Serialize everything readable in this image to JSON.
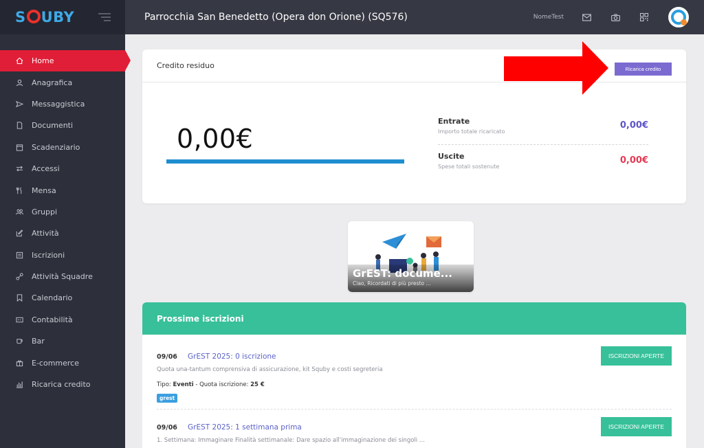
{
  "sidebar": {
    "logo_text": "SQUBY",
    "items": [
      {
        "label": "Home",
        "icon": "home-icon",
        "active": true
      },
      {
        "label": "Anagrafica",
        "icon": "user-icon"
      },
      {
        "label": "Messaggistica",
        "icon": "send-icon"
      },
      {
        "label": "Documenti",
        "icon": "document-icon"
      },
      {
        "label": "Scadenziario",
        "icon": "calendar-icon"
      },
      {
        "label": "Accessi",
        "icon": "swap-icon"
      },
      {
        "label": "Mensa",
        "icon": "cutlery-icon"
      },
      {
        "label": "Gruppi",
        "icon": "group-icon"
      },
      {
        "label": "Attività",
        "icon": "edit-icon"
      },
      {
        "label": "Iscrizioni",
        "icon": "list-icon"
      },
      {
        "label": "Attività Squadre",
        "icon": "link-icon"
      },
      {
        "label": "Calendario",
        "icon": "bookmark-icon"
      },
      {
        "label": "Contabilità",
        "icon": "accounting-icon"
      },
      {
        "label": "Bar",
        "icon": "cup-icon"
      },
      {
        "label": "E-commerce",
        "icon": "cart-icon"
      },
      {
        "label": "Ricarica credito",
        "icon": "chart-icon"
      }
    ]
  },
  "topbar": {
    "title": "Parrocchia San Benedetto (Opera don Orione) (SQ576)",
    "username": "NomeTest",
    "icons": [
      "mail-icon",
      "camera-icon",
      "qr-icon"
    ]
  },
  "credit": {
    "title": "Credito residuo",
    "recharge_label": "Ricarica credito",
    "amount": "0,00€",
    "income": {
      "label": "Entrate",
      "sub": "Importo totale ricaricato",
      "value": "0,00€"
    },
    "expense": {
      "label": "Uscite",
      "sub": "Spese totali sostenute",
      "value": "0,00€"
    }
  },
  "promo": {
    "title": "GrEST: docume...",
    "subtitle": "Ciao, Ricordati di più presto ..."
  },
  "enrollments": {
    "title": "Prossime iscrizioni",
    "items": [
      {
        "date": "09/06",
        "title": "GrEST 2025: 0 iscrizione",
        "desc": "Quota una-tantum comprensiva di assicurazione, kit Squby e costi segreteria",
        "type_label": "Tipo:",
        "type_value": "Eventi",
        "fee_label": "- Quota iscrizione:",
        "fee_value": "25 €",
        "tag": "grest",
        "button": "ISCRIZIONI APERTE"
      },
      {
        "date": "09/06",
        "title": "GrEST 2025: 1 settimana prima",
        "desc": "1. Settimana: Immaginare Finalità settimanale: Dare spazio all'immaginazione dei singoli ...",
        "button": "ISCRIZIONI APERTE"
      }
    ]
  },
  "colors": {
    "sidebar_bg": "#2d2f3a",
    "active": "#e01e37",
    "accent_purple": "#7b6ad0",
    "green": "#37c09a",
    "blue_bar": "#1e8ed0",
    "arrow": "#ff0000"
  }
}
